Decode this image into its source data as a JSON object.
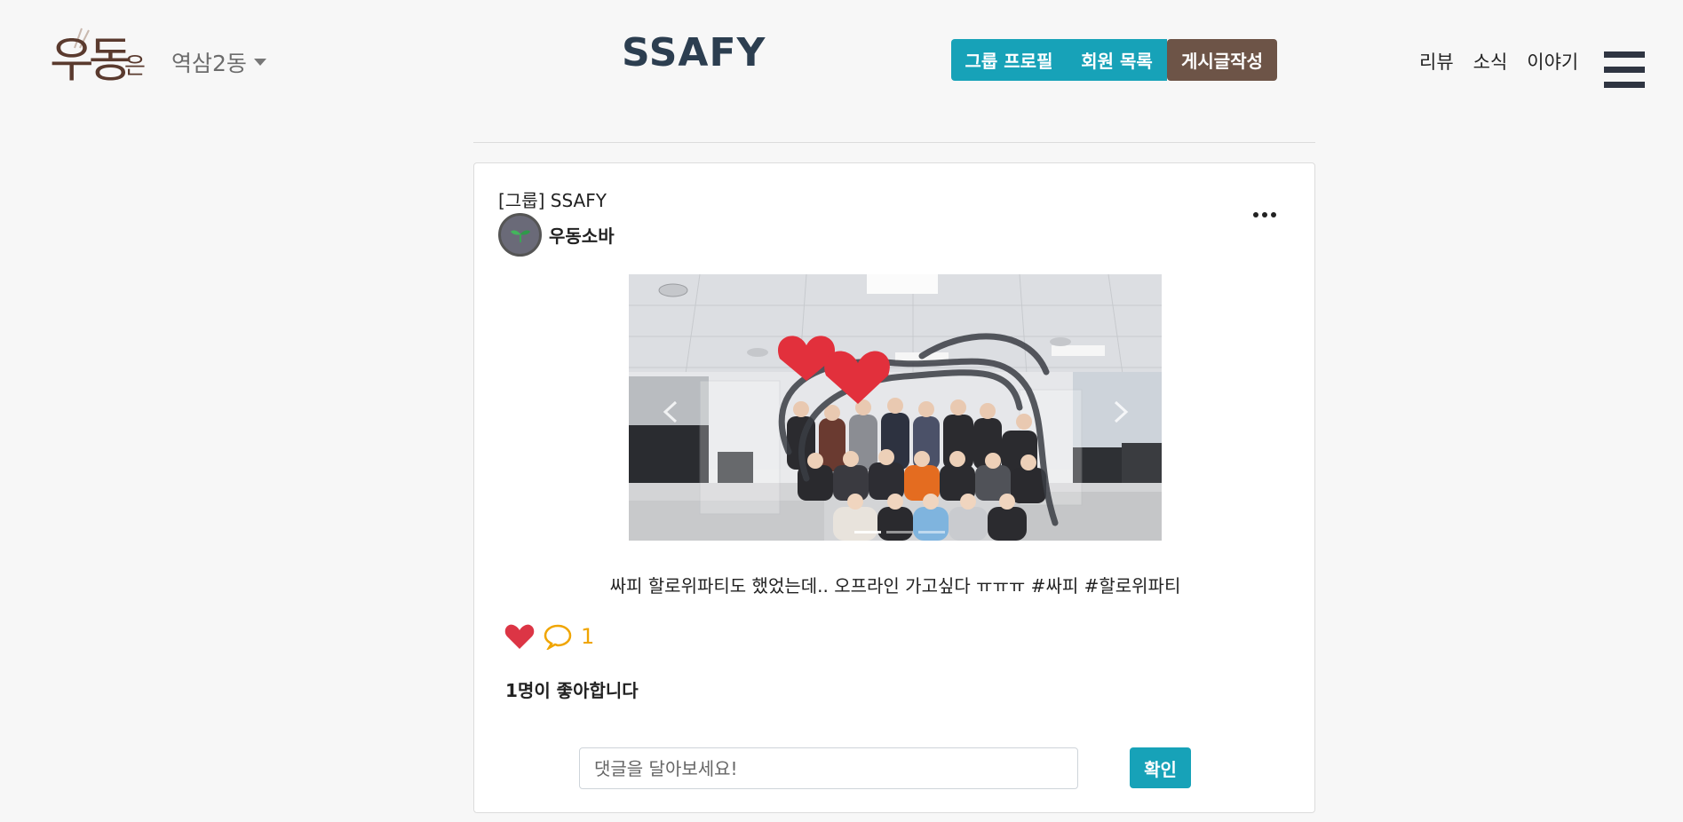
{
  "header": {
    "logo_text": "우동",
    "logo_suffix": "은",
    "location": "역삼2동",
    "brand": "SSAFY",
    "buttons": {
      "group_profile": "그룹 프로필",
      "member_list": "회원 목록",
      "write_post": "게시글작성"
    },
    "nav": [
      "리뷰",
      "소식",
      "이야기"
    ]
  },
  "post": {
    "group_label": "[그룹] SSAFY",
    "author": "우동소바",
    "caption": "싸피 할로위파티도 했었는데.. 오프라인 가고싶다 ㅠㅠㅠ #싸피 #할로위파티",
    "comment_count": "1",
    "likes_text": "1명이 좋아합니다",
    "comment_placeholder": "댓글을 달아보세요!",
    "submit_label": "확인"
  },
  "colors": {
    "teal": "#17a2b8",
    "brown": "#6d5447",
    "heart": "#dc3545",
    "comment": "#f0a500"
  }
}
